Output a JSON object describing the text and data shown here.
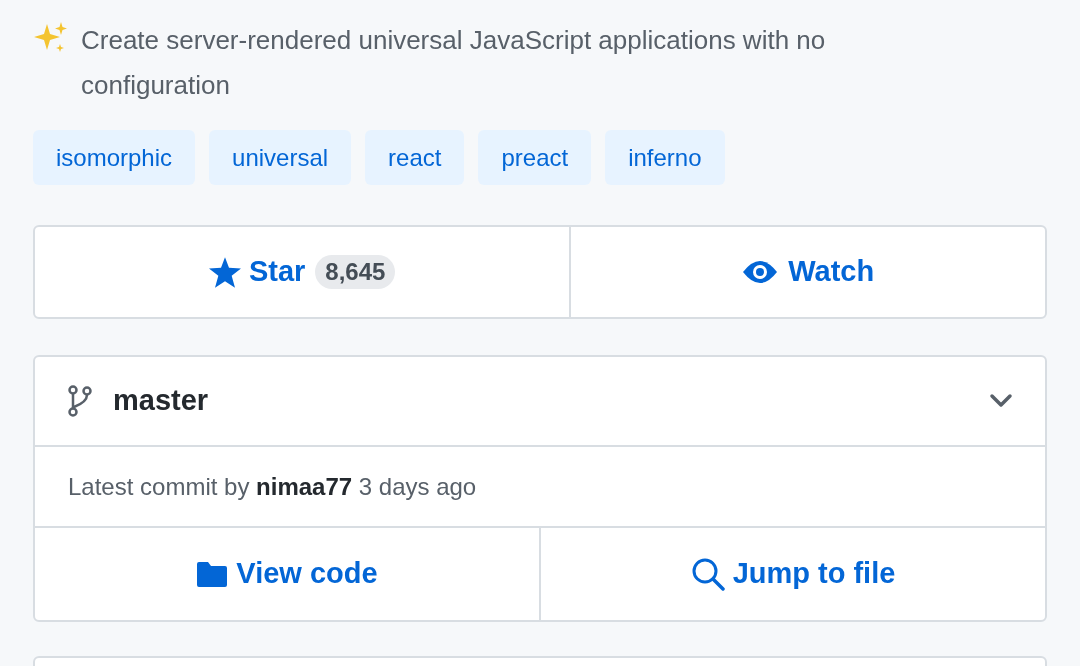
{
  "description": "Create server-rendered universal JavaScript applications with no configuration",
  "topics": [
    "isomorphic",
    "universal",
    "react",
    "preact",
    "inferno"
  ],
  "star": {
    "label": "Star",
    "count": "8,645"
  },
  "watch": {
    "label": "Watch"
  },
  "branch": {
    "name": "master",
    "expanded": false
  },
  "commit": "Latest commit by **nimaa77** 3 days ago",
  "actions": [
    {
      "kind": "code",
      "label": "View code"
    },
    {
      "kind": "search",
      "label": "Jump to file"
    }
  ]
}
